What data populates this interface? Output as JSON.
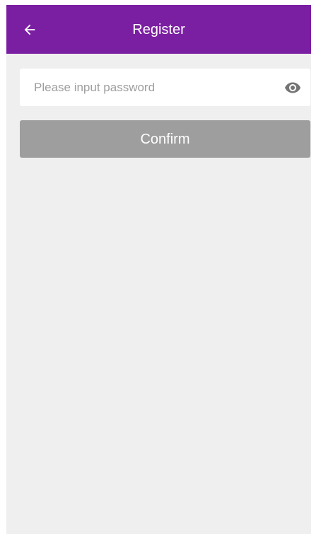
{
  "app_bar": {
    "title": "Register",
    "back_icon": "arrow-left-icon",
    "color": "#7b1fa2"
  },
  "password": {
    "value": "",
    "placeholder": "Please input password",
    "visibility_icon": "eye-icon"
  },
  "confirm": {
    "label": "Confirm",
    "color": "#9e9e9e"
  },
  "background_color": "#efefef"
}
